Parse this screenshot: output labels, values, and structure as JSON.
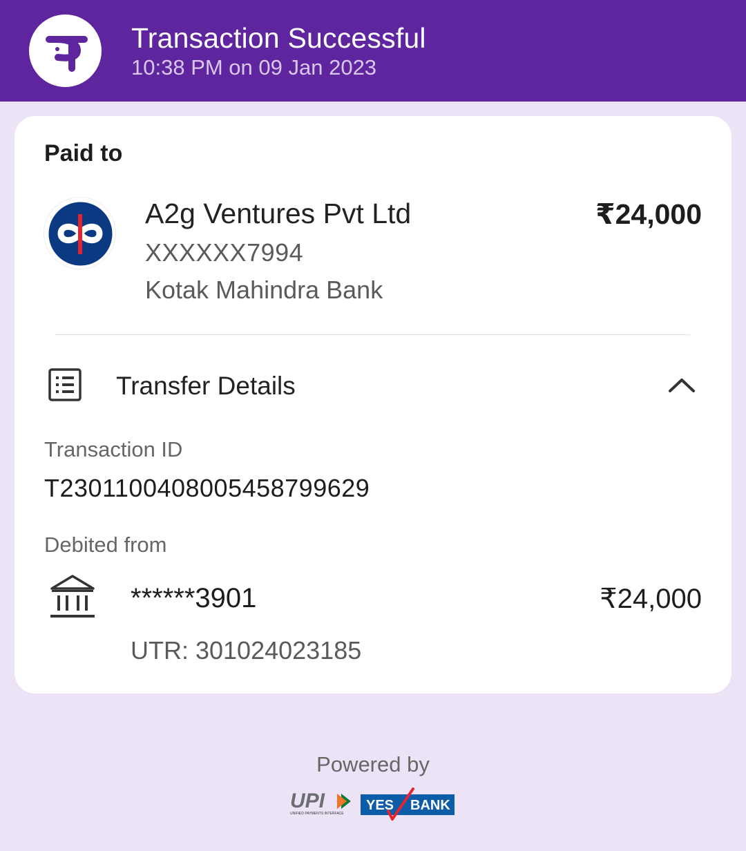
{
  "header": {
    "title": "Transaction Successful",
    "timestamp": "10:38 PM on 09 Jan 2023",
    "logo_icon": "phonepe-logo-icon",
    "background": "#5f259f"
  },
  "paid_to": {
    "label": "Paid to",
    "name": "A2g Ventures Pvt Ltd",
    "account": "XXXXXX7994",
    "bank": "Kotak Mahindra Bank",
    "amount": "₹24,000",
    "bank_logo_icon": "kotak-bank-logo-icon"
  },
  "transfer_details": {
    "label": "Transfer Details",
    "icon": "receipt-icon",
    "toggle_icon": "chevron-up-icon",
    "transaction_id_label": "Transaction ID",
    "transaction_id": "T2301100408005458799629",
    "debited_from_label": "Debited from",
    "debit_account": "******3901",
    "debit_amount": "₹24,000",
    "utr": "UTR: 301024023185",
    "bank_icon": "bank-icon"
  },
  "footer": {
    "powered_by": "Powered by",
    "upi_text": "UPI",
    "upi_tagline": "UNIFIED PAYMENTS INTERFACE",
    "yes_text": "YES",
    "bank_text": "BANK"
  },
  "colors": {
    "brand_purple": "#5f259f",
    "page_background": "#ede3f6",
    "kotak_blue": "#0b3a82",
    "kotak_red": "#e4252f",
    "yes_bank_blue": "#0c5ca8"
  }
}
